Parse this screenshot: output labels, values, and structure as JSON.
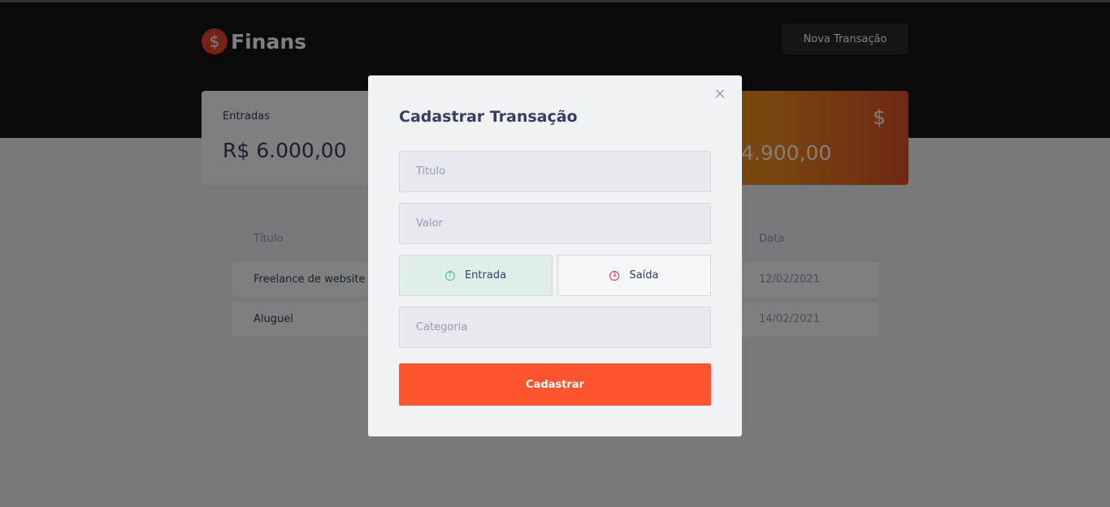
{
  "app": {
    "logo_symbol": "$",
    "name": "Finans"
  },
  "header": {
    "new_transaction_label": "Nova Transação"
  },
  "summary": {
    "income": {
      "label": "Entradas",
      "value": "R$ 6.000,00"
    },
    "total": {
      "value": "4.900,00",
      "icon": "dollar-icon"
    }
  },
  "table": {
    "headers": {
      "title": "Título",
      "date": "Data"
    },
    "rows": [
      {
        "title": "Freelance de website",
        "date": "12/02/2021"
      },
      {
        "title": "Aluguel",
        "date": "14/02/2021"
      }
    ]
  },
  "modal": {
    "close_glyph": "×",
    "title": "Cadastrar Transação",
    "title_placeholder": "Titulo",
    "value_placeholder": "Valor",
    "type_income_label": "Entrada",
    "type_outcome_label": "Saída",
    "category_placeholder": "Categoria",
    "submit_label": "Cadastrar"
  },
  "colors": {
    "accent": "#ff552f",
    "income": "#33cc95",
    "outcome": "#e52e4d",
    "header_bg": "#141414"
  }
}
